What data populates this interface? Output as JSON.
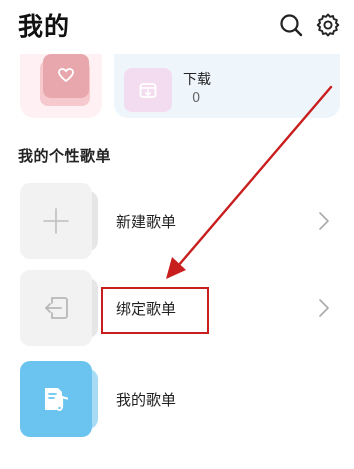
{
  "header": {
    "title": "我的",
    "search_icon": "search-icon",
    "settings_icon": "gear-icon"
  },
  "top_cards": {
    "liked": {
      "icon": "heart-icon",
      "color": "#e7a7ad"
    },
    "download": {
      "title": "下载",
      "count": "0",
      "icon": "download-box-icon",
      "color": "#f3dcef"
    }
  },
  "playlists": {
    "heading": "我的个性歌单",
    "items": [
      {
        "label": "新建歌单",
        "icon": "plus-icon",
        "chevron": true
      },
      {
        "label": "绑定歌单",
        "icon": "import-icon",
        "chevron": true,
        "highlighted": true
      },
      {
        "label": "我的歌单",
        "icon": "music-doc-icon",
        "chevron": false
      }
    ]
  },
  "annotation": {
    "color": "#c81e1e",
    "target": "绑定歌单"
  }
}
